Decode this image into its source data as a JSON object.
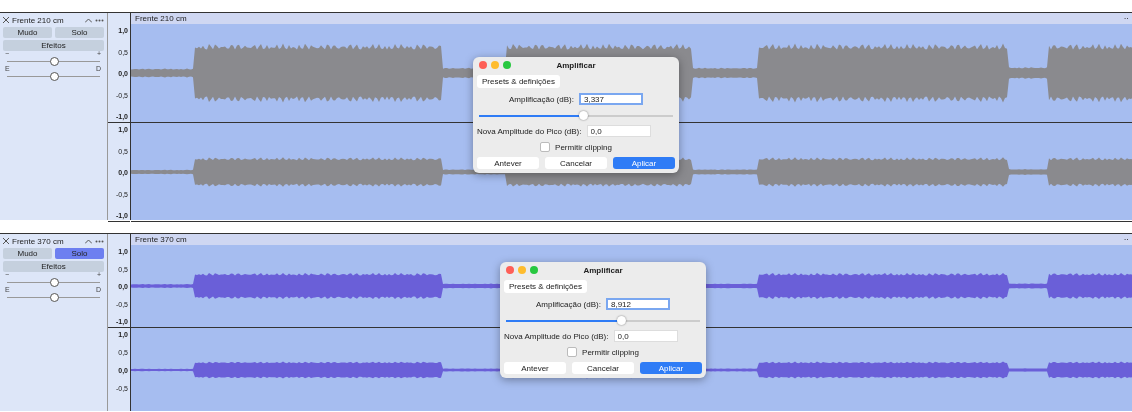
{
  "tracks": [
    {
      "name": "Frente 210 cm",
      "mute": {
        "label": "Mudo",
        "on": false
      },
      "solo": {
        "label": "Solo",
        "on": false
      },
      "effects": "Efeitos",
      "gain": {
        "min": "−",
        "max": "+",
        "level": 0.5
      },
      "pan": {
        "min": "E",
        "max": "D",
        "level": 0.5
      },
      "title": "Frente 210 cm",
      "menu": "··",
      "color": "#8a8a8e",
      "channels": [
        {
          "ticks": [
            "1,0",
            "0,5",
            "0,0",
            "-0,5",
            "-1,0"
          ]
        },
        {
          "ticks": [
            "1,0",
            "0,5",
            "0,0",
            "-0,5",
            "-1,0"
          ]
        }
      ],
      "dialog": {
        "title": "Amplificar",
        "presets": "Presets & definições",
        "amp_label": "Amplificação (dB):",
        "amp_value": "3,337",
        "amp_slider": {
          "level": 0.54
        },
        "peak_label": "Nova Amplitude do Pico (dB):",
        "peak_value": "0,0",
        "clipping": {
          "label": "Permitir clipping",
          "checked": false
        },
        "buttons": [
          {
            "label": "Antever",
            "primary": false
          },
          {
            "label": "Cancelar",
            "primary": false
          },
          {
            "label": "Aplicar",
            "primary": true
          }
        ]
      }
    },
    {
      "name": "Frente 370 cm",
      "mute": {
        "label": "Mudo",
        "on": false
      },
      "solo": {
        "label": "Solo",
        "on": true
      },
      "effects": "Efeitos",
      "gain": {
        "min": "−",
        "max": "+",
        "level": 0.5
      },
      "pan": {
        "min": "E",
        "max": "D",
        "level": 0.5
      },
      "title": "Frente 370 cm",
      "menu": "··",
      "color": "#6a5fd8",
      "channels": [
        {
          "ticks": [
            "1,0",
            "0,5",
            "0,0",
            "-0,5",
            "-1,0"
          ]
        },
        {
          "ticks": [
            "1,0",
            "0,5",
            "0,0",
            "-0,5"
          ]
        }
      ],
      "dialog": {
        "title": "Amplificar",
        "presets": "Presets & definições",
        "amp_label": "Amplificação (dB):",
        "amp_value": "8,912",
        "amp_slider": {
          "level": 0.6
        },
        "peak_label": "Nova Amplitude do Pico (dB):",
        "peak_value": "0,0",
        "clipping": {
          "label": "Permitir clipping",
          "checked": false
        },
        "buttons": [
          {
            "label": "Antever",
            "primary": false
          },
          {
            "label": "Cancelar",
            "primary": false
          },
          {
            "label": "Aplicar",
            "primary": true
          }
        ]
      }
    }
  ]
}
